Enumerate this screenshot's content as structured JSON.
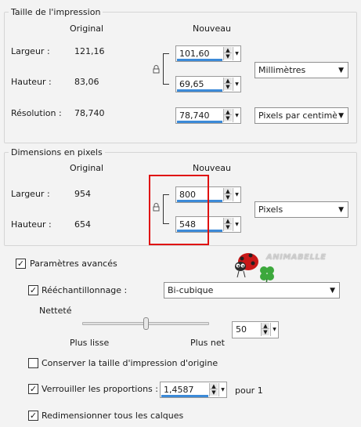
{
  "print_size": {
    "title": "Taille de l'impression",
    "col_original": "Original",
    "col_new": "Nouveau",
    "width_label": "Largeur :",
    "width_original": "121,16",
    "width_new": "101,60",
    "height_label": "Hauteur :",
    "height_original": "83,06",
    "height_new": "69,65",
    "unit": "Millimètres",
    "resolution_label": "Résolution :",
    "resolution_original": "78,740",
    "resolution_new": "78,740",
    "resolution_unit": "Pixels par centimèt"
  },
  "pixel_dims": {
    "title": "Dimensions en pixels",
    "col_original": "Original",
    "col_new": "Nouveau",
    "width_label": "Largeur :",
    "width_original": "954",
    "width_new": "800",
    "height_label": "Hauteur :",
    "height_original": "654",
    "height_new": "548",
    "unit": "Pixels"
  },
  "advanced": {
    "label": "Paramètres avancés",
    "checked": true,
    "resample_label": "Rééchantillonnage :",
    "resample_checked": true,
    "resample_method": "Bi-cubique",
    "sharpness_label": "Netteté",
    "slider_left": "Plus lisse",
    "slider_right": "Plus net",
    "sharpness_value": "50",
    "sharpness_fraction": 0.5,
    "keep_print_size_label": "Conserver la taille d'impression d'origine",
    "keep_print_size_checked": false,
    "lock_ratio_label": "Verrouiller les proportions :",
    "lock_ratio_checked": true,
    "ratio_value": "1,4587",
    "ratio_suffix": "pour 1",
    "resize_layers_label": "Redimensionner tous les calques",
    "resize_layers_checked": true
  },
  "watermark": {
    "text": "ANIMABELLE"
  },
  "colors": {
    "highlight_box": "#e01010",
    "value_underline": "#3c8ad8"
  }
}
